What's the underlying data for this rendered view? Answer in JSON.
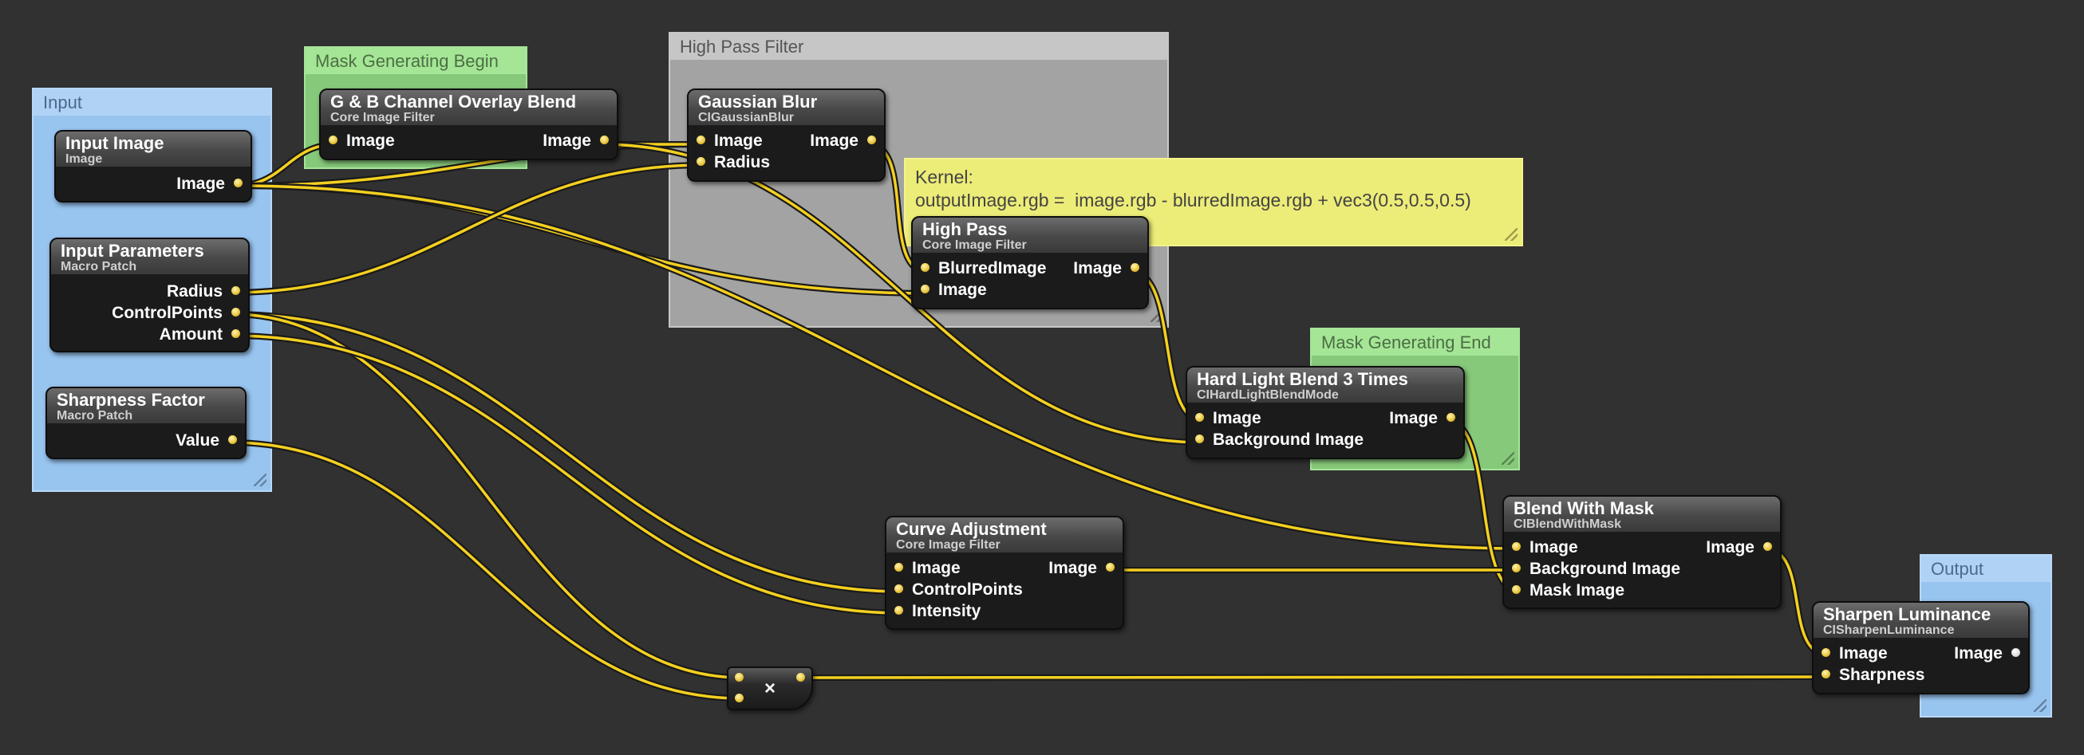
{
  "groups": {
    "input": "Input",
    "mask_begin": "Mask Generating Begin",
    "high_pass_filter": "High Pass Filter",
    "mask_end": "Mask Generating End",
    "output": "Output"
  },
  "note": {
    "line1": "Kernel:",
    "line2": "outputImage.rgb =  image.rgb - blurredImage.rgb + vec3(0.5,0.5,0.5)"
  },
  "nodes": {
    "input_image": {
      "title": "Input Image",
      "subtitle": "Image",
      "outputs": [
        "Image"
      ]
    },
    "input_parameters": {
      "title": "Input Parameters",
      "subtitle": "Macro Patch",
      "outputs": [
        "Radius",
        "ControlPoints",
        "Amount"
      ]
    },
    "sharpness_factor": {
      "title": "Sharpness Factor",
      "subtitle": "Macro Patch",
      "outputs": [
        "Value"
      ]
    },
    "gb_overlay": {
      "title": "G & B Channel Overlay Blend",
      "subtitle": "Core Image Filter",
      "inputs": [
        "Image"
      ],
      "outputs": [
        "Image"
      ]
    },
    "gaussian_blur": {
      "title": "Gaussian Blur",
      "subtitle": "CIGaussianBlur",
      "inputs": [
        "Image",
        "Radius"
      ],
      "outputs": [
        "Image"
      ]
    },
    "high_pass": {
      "title": "High Pass",
      "subtitle": "Core Image Filter",
      "inputs": [
        "BlurredImage",
        "Image"
      ],
      "outputs": [
        "Image"
      ]
    },
    "hard_light": {
      "title": "Hard Light Blend 3 Times",
      "subtitle": "CIHardLightBlendMode",
      "inputs": [
        "Image",
        "Background Image"
      ],
      "outputs": [
        "Image"
      ]
    },
    "blend_with_mask": {
      "title": "Blend With Mask",
      "subtitle": "CIBlendWithMask",
      "inputs": [
        "Image",
        "Background Image",
        "Mask Image"
      ],
      "outputs": [
        "Image"
      ]
    },
    "curve_adjustment": {
      "title": "Curve Adjustment",
      "subtitle": "Core Image Filter",
      "inputs": [
        "Image",
        "ControlPoints",
        "Intensity"
      ],
      "outputs": [
        "Image"
      ]
    },
    "multiply": {
      "symbol": "×"
    },
    "sharpen_luminance": {
      "title": "Sharpen Luminance",
      "subtitle": "CISharpenLuminance",
      "inputs": [
        "Image",
        "Sharpness"
      ],
      "outputs": [
        "Image"
      ]
    }
  },
  "colors": {
    "background": "#313131",
    "wire": "#f5d020",
    "port": "#e8c23a",
    "input_group": "#98c4f0",
    "mask_group": "#86c97a",
    "filter_group": "#a3a3a3",
    "note": "#ecec78"
  }
}
